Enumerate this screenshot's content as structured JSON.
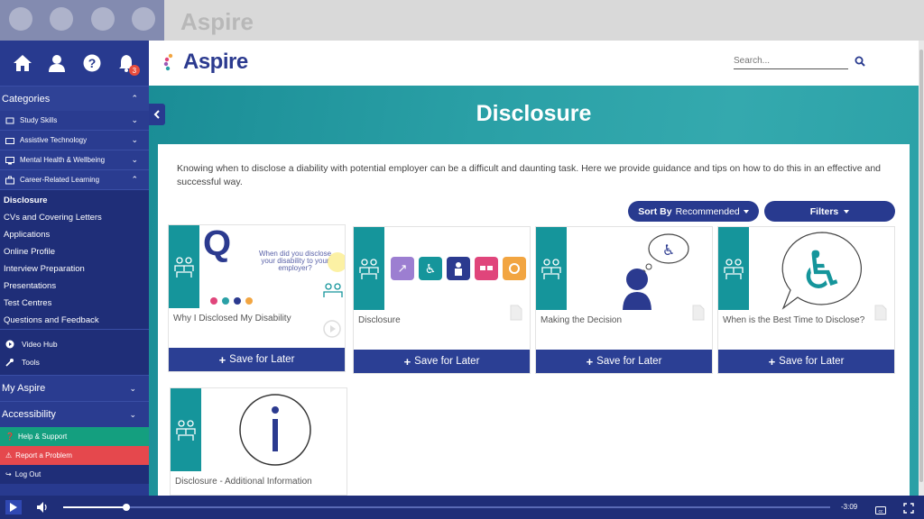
{
  "header": {
    "logo_text": "Aspire",
    "search_placeholder": "Search..."
  },
  "iconbar": {
    "icons": [
      "home-icon",
      "user-icon",
      "help-icon",
      "bell-icon"
    ],
    "notification_count": "3"
  },
  "sidebar": {
    "categories_label": "Categories",
    "category_items": [
      {
        "label": "Study Skills",
        "icon": "book-icon"
      },
      {
        "label": "Assistive Technology",
        "icon": "keyboard-icon"
      },
      {
        "label": "Mental Health & Wellbeing",
        "icon": "monitor-icon"
      },
      {
        "label": "Career-Related Learning",
        "icon": "briefcase-icon"
      }
    ],
    "sub_items": [
      "Disclosure",
      "CVs and Covering Letters",
      "Applications",
      "Online Profile",
      "Interview Preparation",
      "Presentations",
      "Test Centres",
      "Questions and Feedback"
    ],
    "video_hub": "Video Hub",
    "tools": "Tools",
    "my_aspire": "My Aspire",
    "accessibility": "Accessibility",
    "help_support": "Help & Support",
    "report_problem": "Report a Problem",
    "log_out": "Log Out"
  },
  "main": {
    "title": "Disclosure",
    "intro": "Knowing when to disclose a diability with potential employer can be a difficult and daunting task. Here we provide guidance and tips on how to do this in an effective and successful way.",
    "sort_by_label": "Sort By",
    "sort_value": "Recommended",
    "filters_label": "Filters",
    "save_label": "Save for Later",
    "cards": [
      {
        "title": "Why I Disclosed My Disability",
        "thumb_text": "When did you disclose your disability to your employer?",
        "q_letter": "Q"
      },
      {
        "title": "Disclosure"
      },
      {
        "title": "Making the Decision"
      },
      {
        "title": "When is the Best Time to Disclose?"
      },
      {
        "title": "Disclosure - Additional Information"
      }
    ]
  },
  "player": {
    "time_remaining": "-3:09",
    "progress": 0.082
  },
  "colors": {
    "navy": "#283a8f",
    "teal": "#15959b",
    "help_green": "#149f7f",
    "report_red": "#e5484d"
  }
}
